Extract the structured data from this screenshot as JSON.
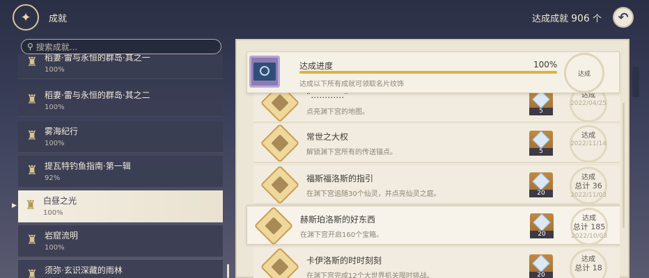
{
  "header": {
    "title": "成就",
    "total_label": "达成成就",
    "total_value": "906",
    "total_unit": "个",
    "emblem_icon": "achievement-emblem-icon",
    "back_icon": "back-arrow-icon"
  },
  "search": {
    "placeholder": "搜索成就..."
  },
  "categories": [
    {
      "name": "稻妻·雷与永恒的群岛·其之一",
      "pct": "100%"
    },
    {
      "name": "稻妻·雷与永恒的群岛·其之二",
      "pct": "100%"
    },
    {
      "name": "雾海纪行",
      "pct": "100%"
    },
    {
      "name": "提瓦特钓鱼指南·第一辑",
      "pct": "92%"
    },
    {
      "name": "白昼之光",
      "pct": "100%"
    },
    {
      "name": "岩窟流明",
      "pct": "100%"
    },
    {
      "name": "须弥·玄识深藏的雨林",
      "pct": ""
    }
  ],
  "progress": {
    "title": "达成进度",
    "pct_text": "100%",
    "fraction": 1.0,
    "desc": "达成以下所有成就可领取名片纹饰",
    "stamp": "达成"
  },
  "achievements": [
    {
      "title": "“…………”",
      "desc": "点亮渊下宫的地图。",
      "reward_qty": "5",
      "status": "达成",
      "count": "",
      "date": "2022/04/25"
    },
    {
      "title": "常世之大权",
      "desc": "解锁渊下宫所有的传送锚点。",
      "reward_qty": "5",
      "status": "达成",
      "count": "",
      "date": "2022/11/14"
    },
    {
      "title": "福斯福洛斯的指引",
      "desc": "在渊下宫追随30个仙灵，并点亮仙灵之庭。",
      "reward_qty": "20",
      "status": "达成",
      "count": "总计 36",
      "date": "2022/11/03"
    },
    {
      "title": "赫斯珀洛斯的好东西",
      "desc": "在渊下宫开启160个宝箱。",
      "reward_qty": "20",
      "status": "达成",
      "count": "总计 185",
      "date": "2022/10/03"
    },
    {
      "title": "卡伊洛斯的时时刻刻",
      "desc": "在渊下宫完成12个大世界机关限时挑战。",
      "reward_qty": "20",
      "status": "达成",
      "count": "总计 18",
      "date": ""
    }
  ]
}
